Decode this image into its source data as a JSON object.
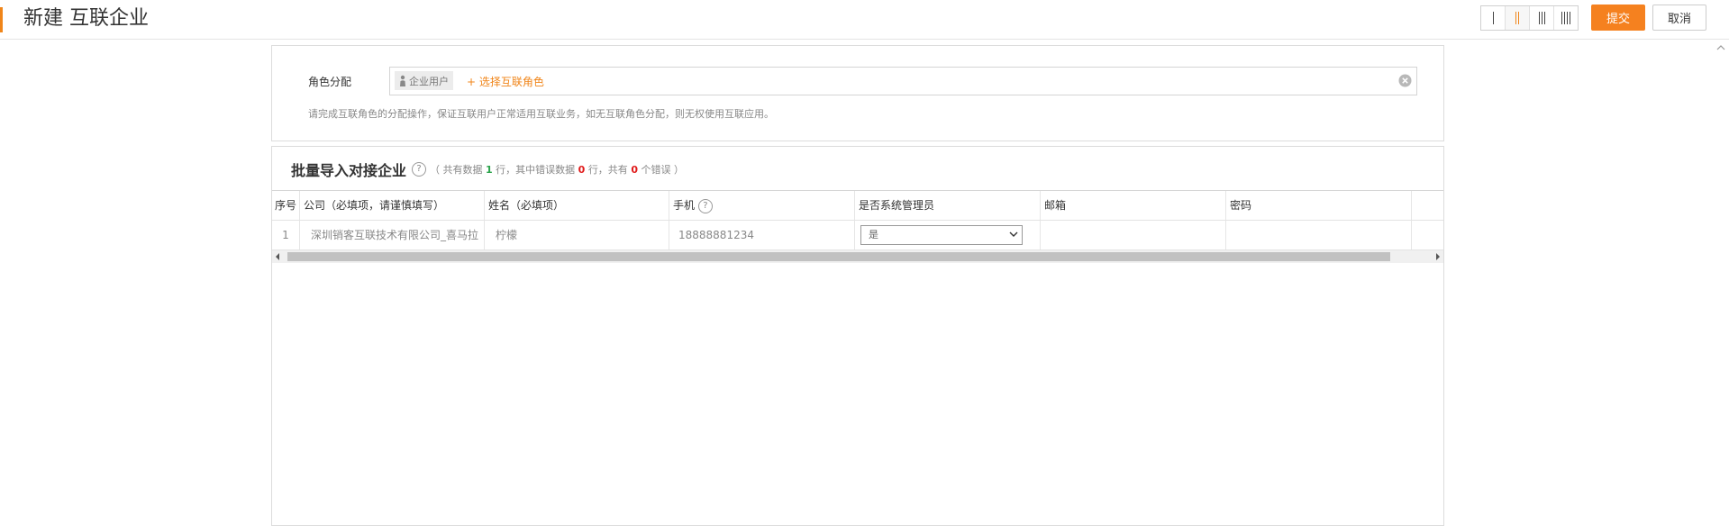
{
  "header": {
    "title": "新建 互联企业",
    "submit_label": "提交",
    "cancel_label": "取消",
    "layout_options": [
      "1-column",
      "2-column",
      "3-column",
      "4-column"
    ],
    "active_layout": "2-column",
    "accent_color": "#f08519"
  },
  "role": {
    "label": "角色分配",
    "tag": "企业用户",
    "add_label": "+ 选择互联角色",
    "hint": "请完成互联角色的分配操作，保证互联用户正常适用互联业务，如无互联角色分配，则无权使用互联应用。"
  },
  "table": {
    "title": "批量导入对接企业",
    "summary_open": "（ 共有数据",
    "total_rows": "1",
    "summary_mid1": "行，其中错误数据",
    "error_rows": "0",
    "summary_mid2": "行，共有",
    "error_count": "0",
    "summary_close": "个错误 ）",
    "columns": [
      "序号",
      "公司（必填项，请谨慎填写）",
      "姓名（必填项）",
      "手机",
      "是否系统管理员",
      "邮箱",
      "密码",
      ""
    ],
    "rows": [
      {
        "index": "1",
        "company": "深圳销客互联技术有限公司_喜马拉",
        "name": "柠檬",
        "phone": "18888881234",
        "is_admin": "是",
        "email": "",
        "password": ""
      }
    ]
  },
  "icons": {
    "help": "question-circle-icon",
    "clear": "clear-circle-icon",
    "person": "person-icon",
    "dropdown": "chevron-down-icon"
  }
}
